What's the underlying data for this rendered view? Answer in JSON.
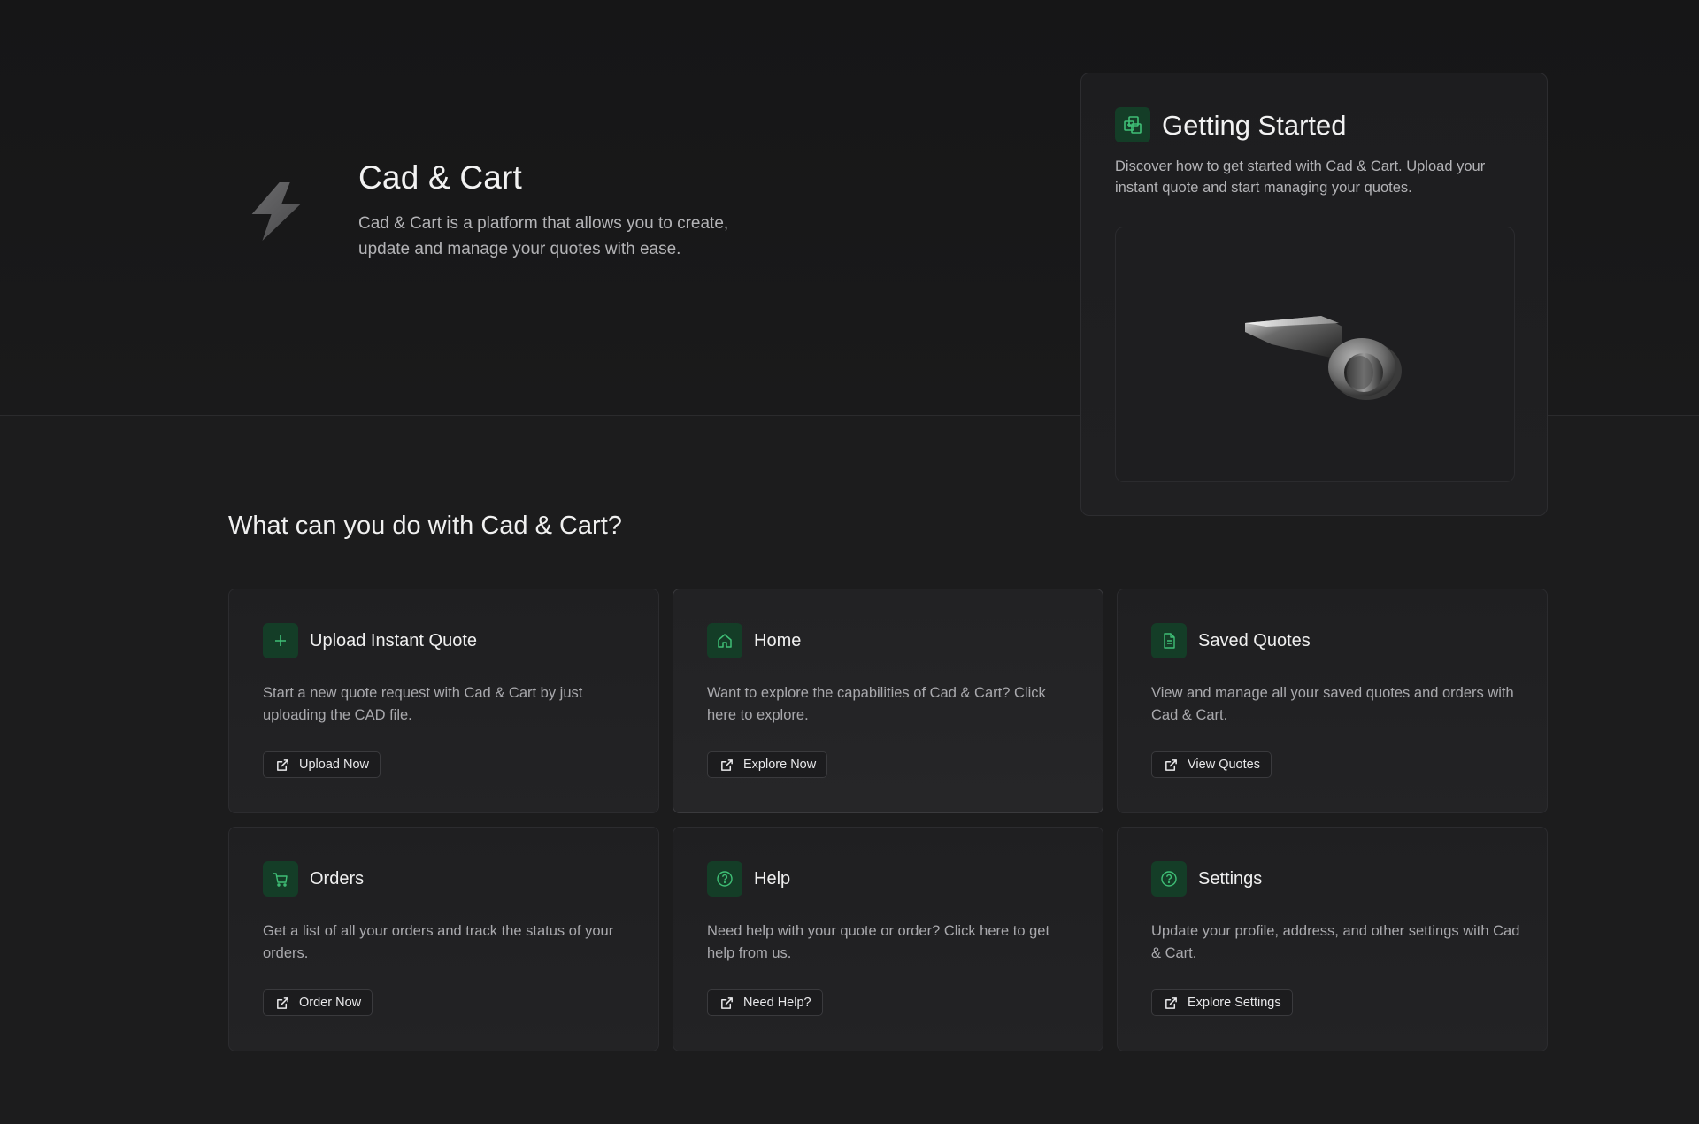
{
  "hero": {
    "title": "Cad & Cart",
    "description": "Cad & Cart is a platform that allows you to create, update and manage your quotes with ease."
  },
  "getting_started": {
    "title": "Getting Started",
    "description": "Discover how to get started with Cad & Cart. Upload your instant quote and start managing your quotes."
  },
  "section": {
    "title": "What can you do with Cad & Cart?"
  },
  "cards": [
    {
      "title": "Upload Instant Quote",
      "description": "Start a new quote request with Cad & Cart by just uploading the CAD file.",
      "button": "Upload Now",
      "icon": "plus-icon"
    },
    {
      "title": "Home",
      "description": "Want to explore the capabilities of Cad & Cart? Click here to explore.",
      "button": "Explore Now",
      "icon": "home-icon"
    },
    {
      "title": "Saved Quotes",
      "description": "View and manage all your saved quotes and orders with Cad & Cart.",
      "button": "View Quotes",
      "icon": "document-icon"
    },
    {
      "title": "Orders",
      "description": "Get a list of all your orders and track the status of your orders.",
      "button": "Order Now",
      "icon": "cart-icon"
    },
    {
      "title": "Help",
      "description": "Need help with your quote or order? Click here to get help from us.",
      "button": "Need Help?",
      "icon": "help-circle-icon"
    },
    {
      "title": "Settings",
      "description": "Update your profile, address, and other settings with Cad & Cart.",
      "button": "Explore Settings",
      "icon": "help-circle-icon"
    }
  ],
  "colors": {
    "background": "#1c1c1d",
    "icon_bg": "#143d27",
    "icon_fg": "#3fbf76",
    "text_primary": "#f0f0f0",
    "text_secondary": "#a9a9ad"
  }
}
